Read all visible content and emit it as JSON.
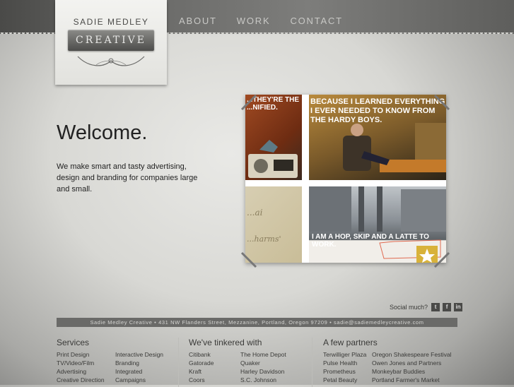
{
  "brand": {
    "name": "SADIE MEDLEY",
    "plate": "CREATIVE"
  },
  "nav": [
    "ABOUT",
    "WORK",
    "CONTACT"
  ],
  "hero": {
    "title": "Welcome.",
    "text": "We make smart and tasty advertising, design and branding for companies large and small."
  },
  "collage": {
    "tile1_caption": "...they're the ...nified.",
    "tile2_caption": "because I learned everything I ever needed to know from the Hardy Boys.",
    "tile3_caption_top": "...ai",
    "tile3_caption_bottom": "...harms'",
    "tile4_caption": "I am a hop, skip and a latte to work."
  },
  "social": {
    "label": "Social much?",
    "icons": [
      "twitter-icon",
      "facebook-icon",
      "linkedin-icon"
    ],
    "icon_glyphs": [
      "t",
      "f",
      "in"
    ]
  },
  "address": "Sadie Medley Creative • 431 NW Flanders Street, Mezzanine, Portland, Oregon 97209 • sadie@sadiemedleycreative.com",
  "footer": {
    "services": {
      "title": "Services",
      "col1": [
        "Print Design",
        "TV/Video/Film",
        "Advertising",
        "Creative Direction"
      ],
      "col2": [
        "Interactive Design",
        "Branding",
        "Integrated",
        "Campaigns"
      ]
    },
    "tinkered": {
      "title": "We've tinkered with",
      "col1": [
        "Citibank",
        "Gatorade",
        "Kraft",
        "Coors"
      ],
      "col2": [
        "The Home Depot",
        "Quaker",
        "Harley Davidson",
        "S.C. Johnson"
      ]
    },
    "partners": {
      "title": "A few partners",
      "col1": [
        "Terwilliger Plaza",
        "Pulse Health",
        "Prometheus",
        "Petal Beauty"
      ],
      "col2": [
        "Oregon Shakespeare Festival",
        "Owen Jones and Partners",
        "Monkeybar Buddies",
        "Portland Farmer's Market"
      ]
    }
  }
}
